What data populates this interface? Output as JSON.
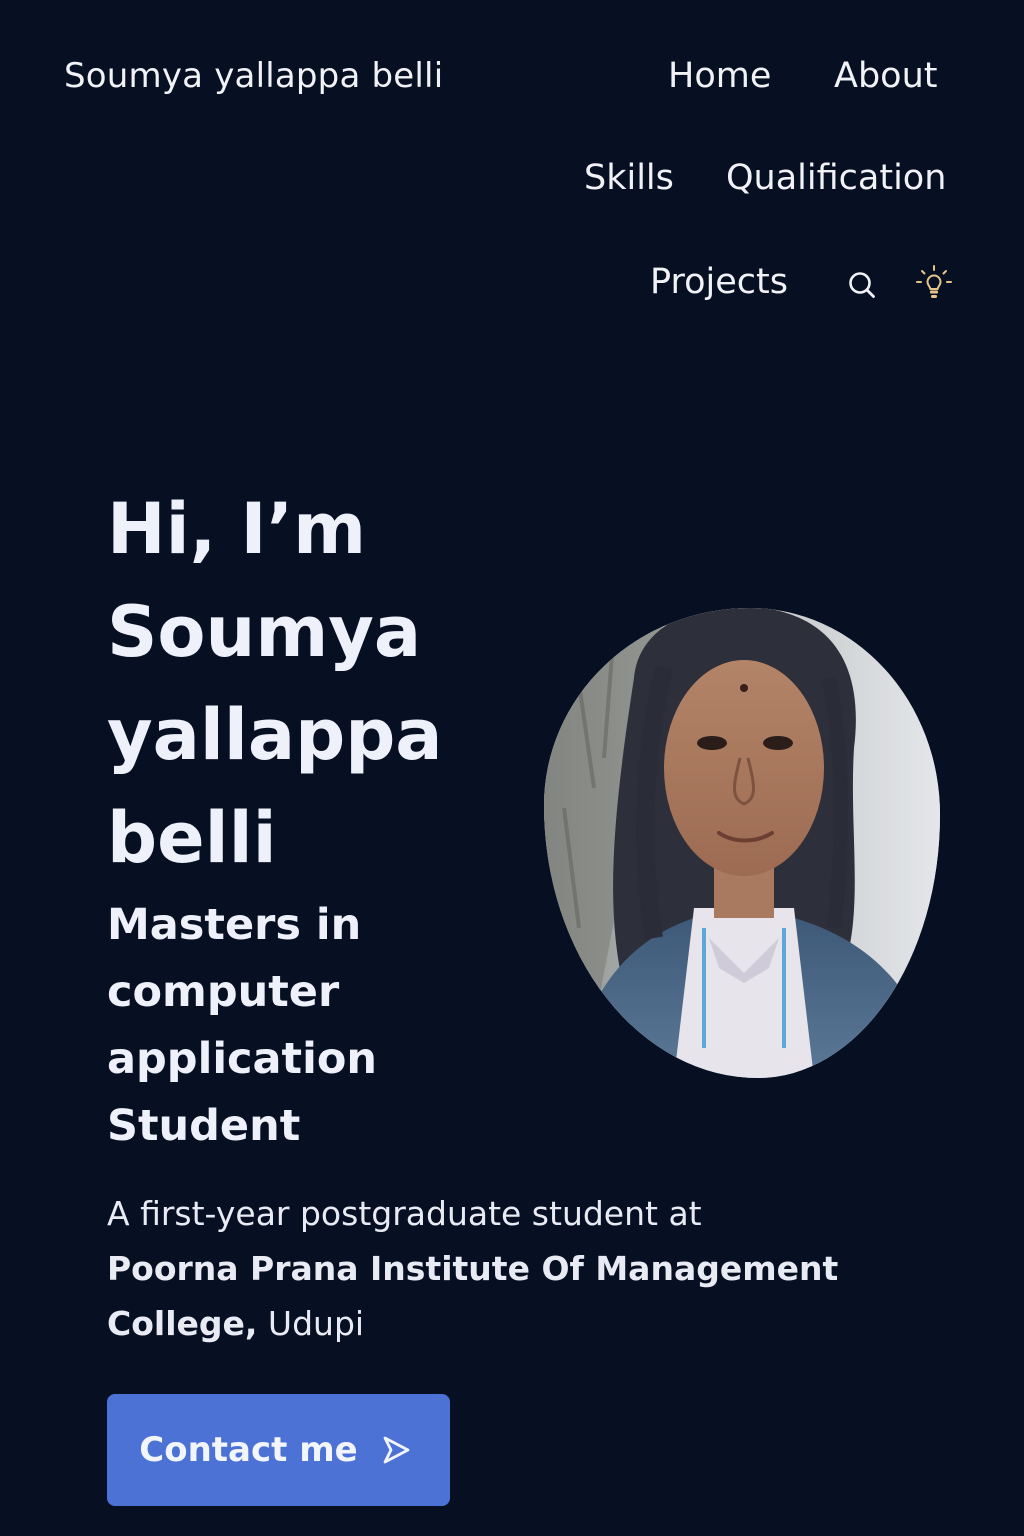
{
  "header": {
    "brand": "Soumya yallappa belli",
    "nav": {
      "home": "Home",
      "about": "About",
      "skills": "Skills",
      "qualification": "Qualification",
      "projects": "Projects"
    },
    "icons": {
      "search": "search-icon",
      "theme": "lightbulb-icon"
    }
  },
  "hero": {
    "title_lines": [
      "Hi, I’m",
      "Soumya",
      "yallappa",
      "belli"
    ],
    "subtitle_lines": [
      "Masters in",
      "computer",
      "application",
      "Student"
    ],
    "description": {
      "line1": "A first-year postgraduate student at",
      "institution": "Poorna Prana Institute Of Management",
      "line3_bold": "College,",
      "line3_rest": " Udupi"
    },
    "contact_button": "Contact me",
    "contact_icon": "send-arrow-icon",
    "portrait": "profile-photo"
  },
  "colors": {
    "background": "#070f22",
    "accent": "#4c72d6",
    "text": "#f1f2f6",
    "theme_icon": "#e8c48a"
  }
}
